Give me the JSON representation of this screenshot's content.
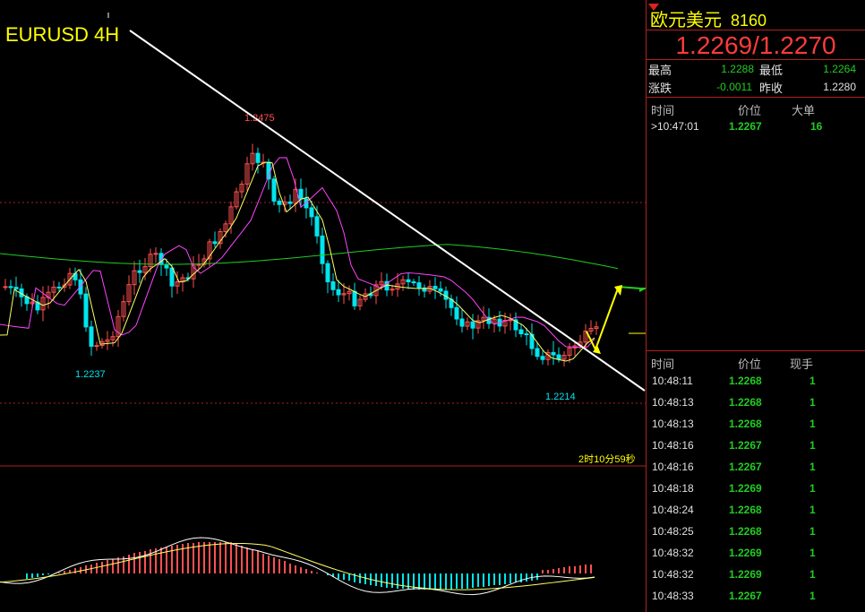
{
  "chart": {
    "title": "EURUSD 4H",
    "timer": "2时10分59秒",
    "high_label": "1.2475",
    "low_label_left": "1.2237",
    "low_label_right": "1.2214"
  },
  "panel": {
    "name": "欧元美元",
    "code": "8160",
    "quote": "1.2269/1.2270",
    "stats": {
      "high_label": "最高",
      "high_value": "1.2288",
      "low_label": "最低",
      "low_value": "1.2264",
      "change_label": "涨跌",
      "change_value": "-0.0011",
      "prev_label": "昨收",
      "prev_value": "1.2280"
    },
    "big_orders": {
      "headers": [
        "时间",
        "价位",
        "大单"
      ],
      "rows": [
        {
          "time": ">10:47:01",
          "price": "1.2267",
          "volume": "16"
        }
      ]
    },
    "ticks": {
      "headers": [
        "时间",
        "价位",
        "现手"
      ],
      "rows": [
        {
          "time": "10:48:11",
          "price": "1.2268",
          "volume": "1"
        },
        {
          "time": "10:48:13",
          "price": "1.2268",
          "volume": "1"
        },
        {
          "time": "10:48:13",
          "price": "1.2268",
          "volume": "1"
        },
        {
          "time": "10:48:16",
          "price": "1.2267",
          "volume": "1"
        },
        {
          "time": "10:48:16",
          "price": "1.2267",
          "volume": "1"
        },
        {
          "time": "10:48:18",
          "price": "1.2269",
          "volume": "1"
        },
        {
          "time": "10:48:24",
          "price": "1.2268",
          "volume": "1"
        },
        {
          "time": "10:48:25",
          "price": "1.2268",
          "volume": "1"
        },
        {
          "time": "10:48:32",
          "price": "1.2269",
          "volume": "1"
        },
        {
          "time": "10:48:32",
          "price": "1.2269",
          "volume": "1"
        },
        {
          "time": "10:48:33",
          "price": "1.2267",
          "volume": "1"
        }
      ]
    }
  },
  "colors": {
    "up": "#ff5050",
    "down": "#00e5ee",
    "ma_fast": "#ffff66",
    "ma_mid": "#ff44ff",
    "ma_slow": "#22cc22",
    "trendline": "#ffffff",
    "grid_dash": "#aa2020"
  }
}
